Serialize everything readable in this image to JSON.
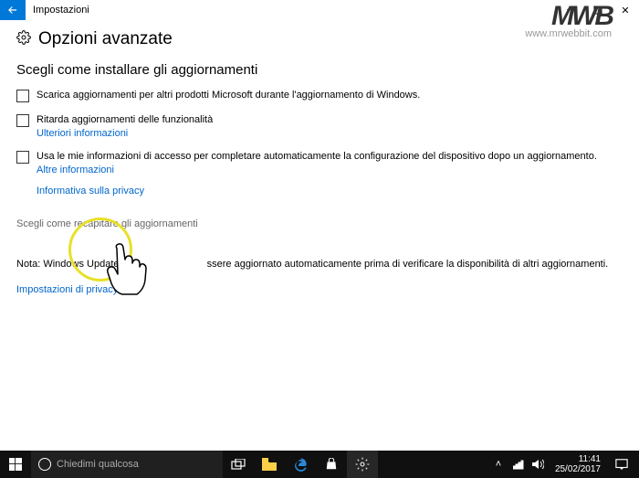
{
  "titlebar": {
    "app": "Impostazioni"
  },
  "watermark": {
    "logo": "MWB",
    "url": "www.mrwebbit.com"
  },
  "header": {
    "title": "Opzioni avanzate"
  },
  "section1": {
    "title": "Scegli come installare gli aggiornamenti"
  },
  "opts": {
    "msProducts": "Scarica aggiornamenti per altri prodotti Microsoft durante l'aggiornamento di Windows.",
    "defer": "Ritarda aggiornamenti delle funzionalità",
    "deferLink": "Ulteriori informazioni",
    "autoSetup": "Usa le mie informazioni di accesso per completare automaticamente la configurazione del dispositivo dopo un aggiornamento.",
    "autoSetupLink": "Altre informazioni"
  },
  "links": {
    "privacyStatement": "Informativa sulla privacy",
    "deliveryOptimization": "Scegli come recapitare gli aggiornamenti",
    "privacySettings": "Impostazioni di privacy"
  },
  "note": {
    "prefix": "Nota: Windows Update",
    "suffix": "ssere aggiornato automaticamente prima di verificare la disponibilità di altri aggiornamenti."
  },
  "taskbar": {
    "searchPlaceholder": "Chiedimi qualcosa",
    "time": "11:41",
    "date": "25/02/2017"
  }
}
